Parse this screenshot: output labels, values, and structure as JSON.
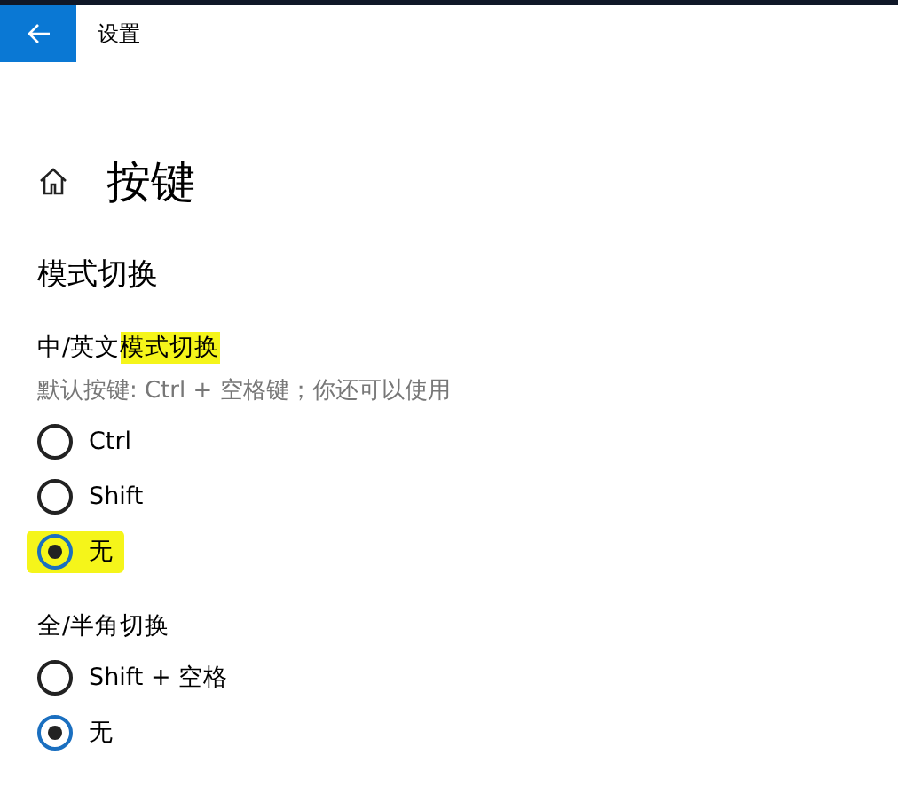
{
  "window": {
    "title": "设置"
  },
  "page": {
    "title": "按键"
  },
  "section": {
    "title": "模式切换"
  },
  "groups": [
    {
      "label_parts": [
        {
          "text": "中/英文",
          "highlighted": false
        },
        {
          "text": "模式切换",
          "highlighted": true
        }
      ],
      "description": "默认按键: Ctrl + 空格键；你还可以使用",
      "options": [
        {
          "label": "Ctrl",
          "selected": false,
          "highlighted": false
        },
        {
          "label": "Shift",
          "selected": false,
          "highlighted": false
        },
        {
          "label": "无",
          "selected": true,
          "highlighted": true
        }
      ]
    },
    {
      "label_parts": [
        {
          "text": "全/半角切换",
          "highlighted": false
        }
      ],
      "options": [
        {
          "label": "Shift + 空格",
          "selected": false,
          "highlighted": false
        },
        {
          "label": "无",
          "selected": true,
          "highlighted": false
        }
      ]
    }
  ]
}
